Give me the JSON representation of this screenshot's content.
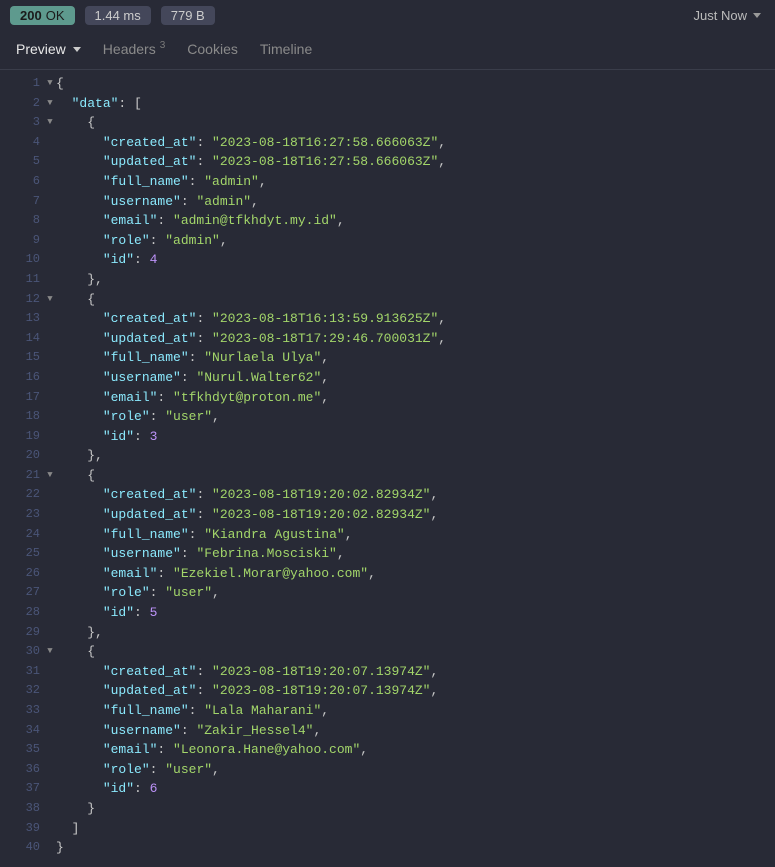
{
  "statusbar": {
    "code": "200",
    "text": "OK",
    "time": "1.44 ms",
    "size": "779 B",
    "when": "Just Now"
  },
  "tabs": {
    "preview": "Preview",
    "headers": "Headers",
    "headers_badge": "3",
    "cookies": "Cookies",
    "timeline": "Timeline"
  },
  "json_body": {
    "data": [
      {
        "created_at": "2023-08-18T16:27:58.666063Z",
        "updated_at": "2023-08-18T16:27:58.666063Z",
        "full_name": "admin",
        "username": "admin",
        "email": "admin@tfkhdyt.my.id",
        "role": "admin",
        "id": 4
      },
      {
        "created_at": "2023-08-18T16:13:59.913625Z",
        "updated_at": "2023-08-18T17:29:46.700031Z",
        "full_name": "Nurlaela Ulya",
        "username": "Nurul.Walter62",
        "email": "tfkhdyt@proton.me",
        "role": "user",
        "id": 3
      },
      {
        "created_at": "2023-08-18T19:20:02.82934Z",
        "updated_at": "2023-08-18T19:20:02.82934Z",
        "full_name": "Kiandra Agustina",
        "username": "Febrina.Mosciski",
        "email": "Ezekiel.Morar@yahoo.com",
        "role": "user",
        "id": 5
      },
      {
        "created_at": "2023-08-18T19:20:07.13974Z",
        "updated_at": "2023-08-18T19:20:07.13974Z",
        "full_name": "Lala Maharani",
        "username": "Zakir_Hessel4",
        "email": "Leonora.Hane@yahoo.com",
        "role": "user",
        "id": 6
      }
    ]
  }
}
